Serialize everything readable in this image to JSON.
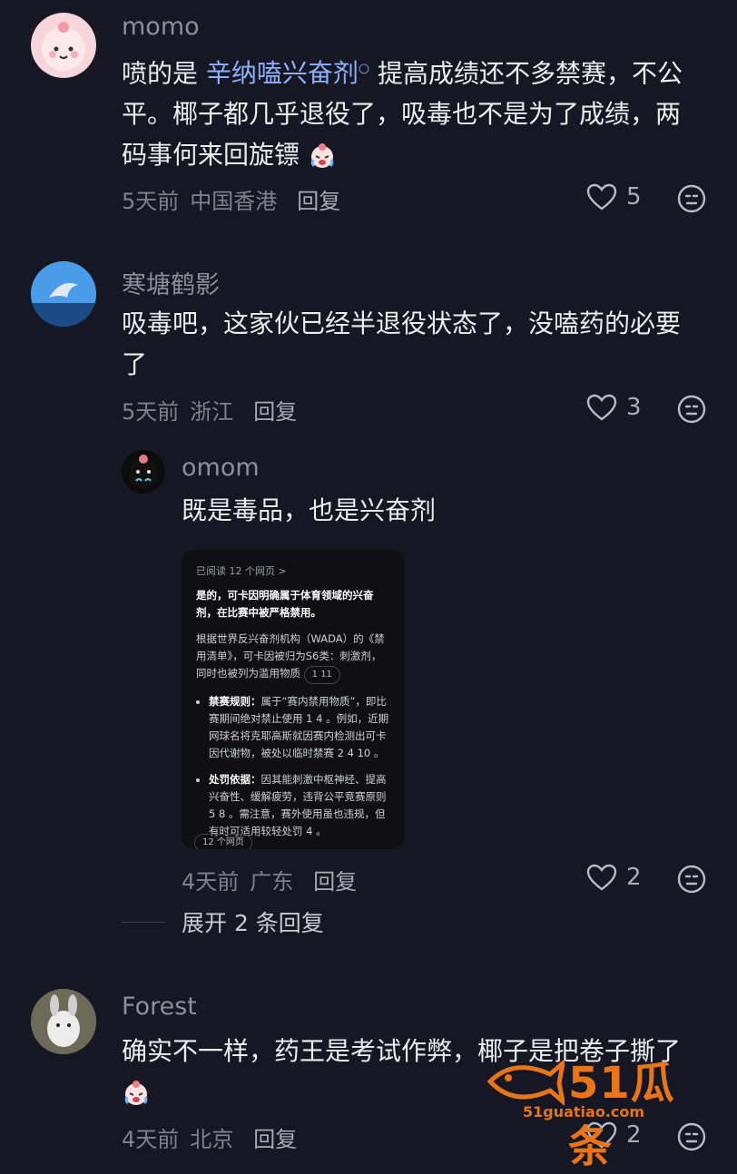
{
  "comments": [
    {
      "user": "momo",
      "text_before": "喷的是 ",
      "keyword": "辛纳嗑兴奋剂",
      "keyword_icon": "search-icon",
      "text_after": " 提高成绩还不多禁赛，不公平。椰子都几乎退役了，吸毒也不是为了成绩，两码事何来回旋镖",
      "time": "5天前",
      "location": "中国香港",
      "reply_label": "回复",
      "likes": "5"
    },
    {
      "user": "寒塘鹤影",
      "text": "吸毒吧，这家伙已经半退役状态了，没嗑药的必要了",
      "time": "5天前",
      "location": "浙江",
      "reply_label": "回复",
      "likes": "3"
    },
    {
      "user": "omom",
      "text": "既是毒品，也是兴奋剂",
      "time": "4天前",
      "location": "广东",
      "reply_label": "回复",
      "likes": "2",
      "card": {
        "header": "已阅读 12 个网页 >",
        "lead": "是的，可卡因明确属于体育领域的兴奋剂，在比赛中被严格禁用。",
        "para": "根据世界反兴奋剂机构（WADA）的《禁用清单》，可卡因被归为S6类：刺激剂，同时也被列为滥用物质",
        "para_refs": "1 11",
        "bullet1_title": "禁赛规则：",
        "bullet1": "属于“赛内禁用物质”，即比赛期间绝对禁止使用 1 4 。例如，近期网球名将克耶高斯就因赛内检测出可卡因代谢物，被处以临时禁赛 2 4 10 。",
        "bullet2_title": "处罚依据：",
        "bullet2": "因其能刺激中枢神经、提高兴奋性、缓解疲劳，违背公平竞赛原则 5 8 。需注意，赛外使用虽也违规，但有时可适用较轻处罚 4 。",
        "sources": "12 个网页"
      }
    },
    {
      "user": "Forest",
      "text": "确实不一样，药王是考试作弊，椰子是把卷子撕了",
      "time": "4天前",
      "location": "北京",
      "reply_label": "回复",
      "likes": "2"
    }
  ],
  "expand_label": "展开 2 条回复",
  "watermark": {
    "logo": "51瓜条",
    "url": "51guatiao.com"
  },
  "colors": {
    "background": "#161722",
    "keyword": "#8fb0ff",
    "watermark": "#e8751a"
  }
}
